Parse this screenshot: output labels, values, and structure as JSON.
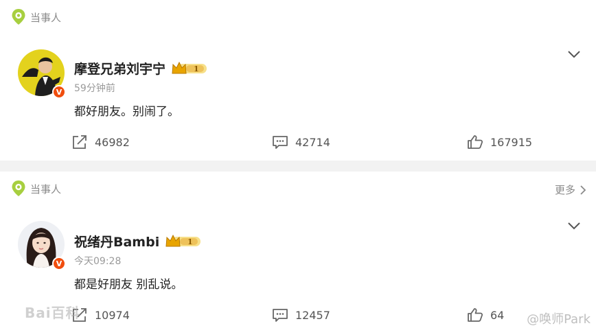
{
  "colors": {
    "source_pin": "#a7cf3f",
    "verified_badge": "#f04d0e",
    "vip_crown": "#e8a400",
    "text_primary": "#222222",
    "text_secondary": "#9a9a9a",
    "icon_gray": "#666666"
  },
  "posts": [
    {
      "source_label": "当事人",
      "username": "摩登兄弟刘宇宁",
      "timestamp": "59分钟前",
      "text": "都好朋友。别闹了。",
      "vip_level": "1",
      "repost_count": "46982",
      "comment_count": "42714",
      "like_count": "167915"
    },
    {
      "source_label": "当事人",
      "more_label": "更多",
      "username": "祝绪丹Bambi",
      "timestamp": "今天09:28",
      "text": "都是好朋友 别乱说。",
      "vip_level": "1",
      "repost_count": "10974",
      "comment_count": "12457"
    }
  ],
  "watermarks": {
    "left": "Bai百科",
    "right": "@唤师Park",
    "partial_like_count": "64"
  },
  "icons": {
    "source": "location-pin-icon",
    "collapse": "chevron-down-icon",
    "more": "chevron-right-icon",
    "repost": "share-icon",
    "comment": "comment-icon",
    "like": "thumbs-up-icon",
    "verified": "verified-v-icon",
    "vip": "crown-vip-icon"
  }
}
